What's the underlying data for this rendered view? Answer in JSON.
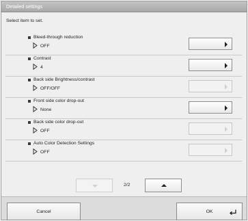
{
  "window": {
    "title": "Detailed settings"
  },
  "instruction": "Select item to set.",
  "items": [
    {
      "label": "Bleed-through reduction",
      "value": "OFF",
      "enabled": true
    },
    {
      "label": "Contrast",
      "value": "4",
      "enabled": true
    },
    {
      "label": "Back side Brightness/contrast",
      "value": "OFF/OFF",
      "enabled": false
    },
    {
      "label": "Front side color drop-out",
      "value": "None",
      "enabled": true
    },
    {
      "label": "Back side color drop-out",
      "value": "OFF",
      "enabled": false
    },
    {
      "label": "Auto Color Detection Settings",
      "value": "OFF",
      "enabled": false
    }
  ],
  "pager": {
    "page_text": "2/2",
    "prev_icon": "triangle-down-icon",
    "next_icon": "triangle-up-icon"
  },
  "footer": {
    "cancel_label": "Cancel",
    "ok_label": "OK",
    "ok_icon": "enter-return-icon"
  },
  "colors": {
    "titlebar": "#b3b3b3",
    "panel": "#efefef",
    "footer": "#dcdcdc"
  }
}
